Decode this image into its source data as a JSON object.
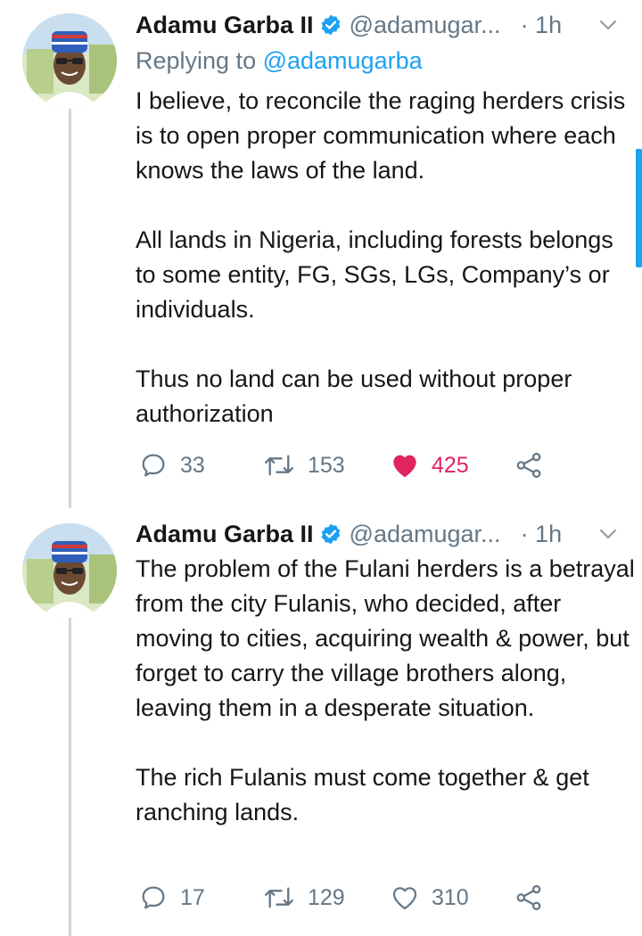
{
  "tweets": [
    {
      "author": "Adamu Garba II",
      "handle": "@adamugar...",
      "time": "· 1h",
      "replying_label": "Replying to ",
      "replying_to": "@adamugarba",
      "text": "I believe, to reconcile the raging herders crisis is to open proper communication where each knows the laws of the land.\n\nAll lands in Nigeria, including forests belongs to some entity, FG, SGs, LGs, Company’s or individuals.\n\nThus no land can be used without proper authorization",
      "replies": "33",
      "retweets": "153",
      "likes": "425",
      "liked": true
    },
    {
      "author": "Adamu Garba II",
      "handle": "@adamugar...",
      "time": "· 1h",
      "text": "The problem of the Fulani herders is a betrayal from the city Fulanis, who decided, after moving to cities, acquiring wealth & power, but forget to carry the village brothers along, leaving them in a desperate situation.\n\nThe rich Fulanis must come together & get ranching lands.",
      "replies": "17",
      "retweets": "129",
      "likes": "310",
      "liked": false
    }
  ],
  "colors": {
    "text": "#14171a",
    "secondary": "#657786",
    "link": "#1da1f2",
    "like": "#e0245e",
    "thread_line": "#ccd6dd"
  },
  "icons": [
    "verified-badge-icon",
    "chevron-down-icon",
    "reply-icon",
    "retweet-icon",
    "heart-icon",
    "share-icon"
  ]
}
